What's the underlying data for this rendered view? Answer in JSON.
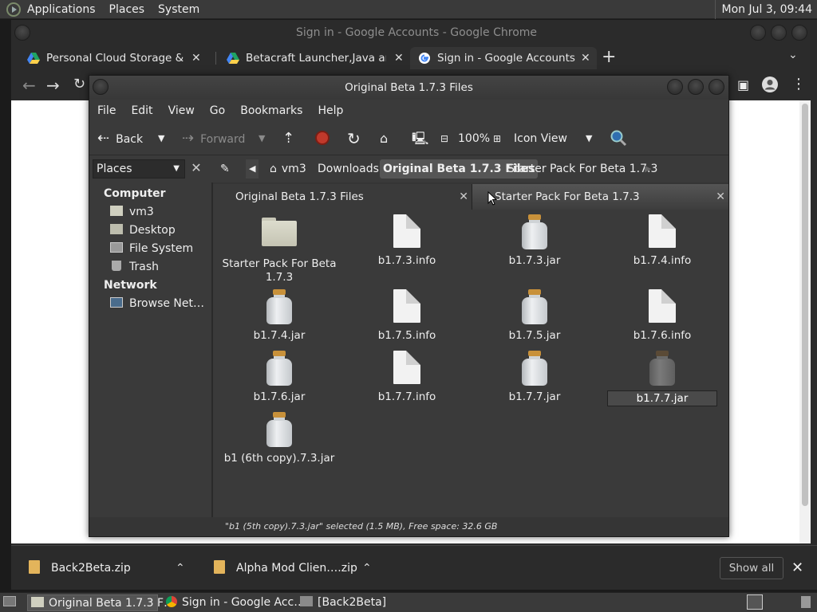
{
  "panel": {
    "menus": [
      "Applications",
      "Places",
      "System"
    ],
    "clock": "Mon Jul  3, 09:44"
  },
  "chrome": {
    "window_title": "Sign in - Google Accounts - Google Chrome",
    "tabs": [
      {
        "title": "Personal Cloud Storage & File",
        "icon": "google-drive-icon"
      },
      {
        "title": "Betacraft Launcher,Java and w",
        "icon": "google-drive-icon"
      },
      {
        "title": "Sign in - Google Accounts",
        "icon": "google-icon"
      }
    ]
  },
  "fm": {
    "title": "Original Beta 1.7.3 Files",
    "menu": [
      "File",
      "Edit",
      "View",
      "Go",
      "Bookmarks",
      "Help"
    ],
    "toolbar": {
      "back": "Back",
      "forward": "Forward",
      "zoom": "100%",
      "view_mode": "Icon View"
    },
    "places_label": "Places",
    "breadcrumbs": [
      "vm3",
      "Downloads",
      "Original Beta 1.7.3 Files",
      "Starter Pack For Beta 1.7.3"
    ],
    "sidebar": {
      "computer_heading": "Computer",
      "computer_items": [
        "vm3",
        "Desktop",
        "File System",
        "Trash"
      ],
      "network_heading": "Network",
      "network_items": [
        "Browse Net…"
      ]
    },
    "view_tabs": [
      "Original Beta 1.7.3 Files",
      "Starter Pack For Beta 1.7.3"
    ],
    "files": [
      {
        "name": "Starter Pack For Beta 1.7.3",
        "kind": "folder"
      },
      {
        "name": "b1.7.3.info",
        "kind": "doc"
      },
      {
        "name": "b1.7.3.jar",
        "kind": "jar"
      },
      {
        "name": "b1.7.4.info",
        "kind": "doc"
      },
      {
        "name": "b1.7.4.jar",
        "kind": "jar"
      },
      {
        "name": "b1.7.5.info",
        "kind": "doc"
      },
      {
        "name": "b1.7.5.jar",
        "kind": "jar"
      },
      {
        "name": "b1.7.6.info",
        "kind": "doc"
      },
      {
        "name": "b1.7.6.jar",
        "kind": "jar"
      },
      {
        "name": "b1.7.7.info",
        "kind": "doc"
      },
      {
        "name": "b1.7.7.jar",
        "kind": "jar"
      },
      {
        "name": "b1.7.7.jar",
        "kind": "jar-renaming"
      },
      {
        "name": "b1 (6th copy).7.3.jar",
        "kind": "jar"
      }
    ],
    "status": "\"b1 (5th copy).7.3.jar\" selected (1.5 MB), Free space: 32.6 GB"
  },
  "downloads": {
    "items": [
      "Back2Beta.zip",
      "Alpha Mod Clien….zip"
    ],
    "show_all": "Show all"
  },
  "taskbar": {
    "tasks": [
      "Original Beta 1.7.3 F…",
      "Sign in - Google Acc…",
      "[Back2Beta]"
    ]
  }
}
